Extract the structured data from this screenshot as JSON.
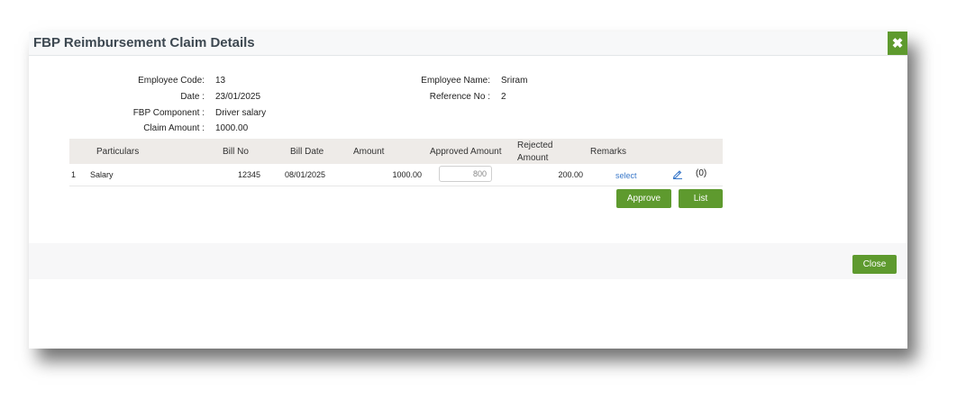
{
  "dialog": {
    "title": "FBP Reimbursement Claim Details",
    "close_icon": "close-icon"
  },
  "details": {
    "employee_code_label": "Employee Code:",
    "employee_code": "13",
    "date_label": "Date :",
    "date": "23/01/2025",
    "fbp_component_label": "FBP Component :",
    "fbp_component": "Driver salary",
    "claim_amount_label": "Claim Amount :",
    "claim_amount": "1000.00",
    "employee_name_label": "Employee Name:",
    "employee_name": "Sriram",
    "reference_no_label": "Reference No :",
    "reference_no": "2"
  },
  "table": {
    "headers": {
      "particulars": "Particulars",
      "bill_no": "Bill No",
      "bill_date": "Bill Date",
      "amount": "Amount",
      "approved_amount": "Approved Amount",
      "rejected_amount_line1": "Rejected",
      "rejected_amount_line2": "Amount",
      "remarks": "Remarks"
    },
    "rows": [
      {
        "index": "1",
        "particulars": "Salary",
        "bill_no": "12345",
        "bill_date": "08/01/2025",
        "amount": "1000.00",
        "approved_amount": "800",
        "rejected_amount": "200.00",
        "remarks_link": "select",
        "edit_icon": "pencil-icon",
        "attachment_count": "(0)"
      }
    ]
  },
  "actions": {
    "approve_label": "Approve",
    "list_label": "List",
    "close_label": "Close"
  },
  "colors": {
    "accent_green": "#5e9a2e",
    "link_blue": "#3a78c9",
    "header_bg": "#eeebe8"
  }
}
